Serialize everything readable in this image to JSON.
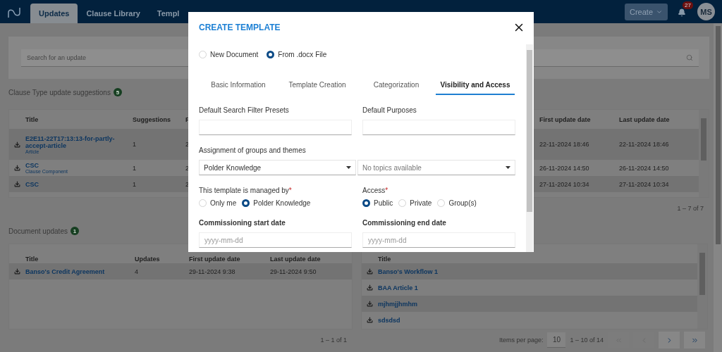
{
  "nav": {
    "tabs": [
      {
        "label": "Updates",
        "selected": true
      },
      {
        "label": "Clause Library",
        "selected": false
      },
      {
        "label": "Templ",
        "selected": false
      }
    ],
    "create": "Create",
    "notifications": "27",
    "avatar": "MS"
  },
  "search": {
    "placeholder": "Search for an update"
  },
  "clause_updates": {
    "title": "Clause Type update suggestions",
    "count": "5",
    "columns": [
      "Title",
      "Suggestions",
      "F",
      "First update date",
      "Last update date"
    ],
    "rows": [
      {
        "title": "E2E11-22T17:13:13-for-partly-accept-article",
        "type": "Article",
        "suggestions": "1",
        "column_3": "2",
        "first": "22-11-2024 18:46",
        "last": "22-11-2024 18:46"
      },
      {
        "title": "CSC",
        "type": "Clause Component",
        "suggestions": "1",
        "column_3": "2",
        "first": "26-11-2024 14:50",
        "last": "26-11-2024 14:50"
      },
      {
        "title": "CSC",
        "suggestions": "1",
        "column_3": "2",
        "first": "27-11-2024 10:34",
        "last": "27-11-2024 10:34"
      }
    ],
    "range": "1 – 7 of 7"
  },
  "document_updates": {
    "title": "Document updates",
    "count": "1",
    "columns": [
      "Title",
      "Updates",
      "First update date",
      "Last update date"
    ],
    "rows": [
      {
        "title": "Banso's Credit Agreement",
        "updates": "4",
        "first": "29-11-2024 9:38",
        "last": "29-11-2024 9:50"
      }
    ],
    "range": "1 – 1 of 1"
  },
  "workflow_updates": {
    "columns": [
      "Title"
    ],
    "rows": [
      {
        "title": "Banso's Workflow 1"
      },
      {
        "title": "BAA Article 1"
      },
      {
        "title": "mjhmjjhmhm"
      },
      {
        "title": "sdsdsd"
      }
    ],
    "items_per_page_label": "Items per page:",
    "items_per_page": "10",
    "range": "1 – 10 of 14",
    "pager": [
      {
        "kind": "first",
        "disabled": true
      },
      {
        "kind": "previous",
        "disabled": true
      },
      {
        "kind": "next",
        "disabled": false
      },
      {
        "kind": "last",
        "disabled": false
      }
    ]
  },
  "modal": {
    "title": "CREATE TEMPLATE",
    "source_options": [
      {
        "label": "New Document",
        "selected": false
      },
      {
        "label": "From .docx File",
        "selected": true
      }
    ],
    "tabs": [
      {
        "label": "Basic Information",
        "selected": false
      },
      {
        "label": "Template Creation",
        "selected": false
      },
      {
        "label": "Categorization",
        "selected": false
      },
      {
        "label": "Visibility and Access",
        "selected": true
      }
    ],
    "filters": [
      {
        "label": "Default Search Filter Presets"
      },
      {
        "label": "Default Purposes"
      }
    ],
    "assignment": {
      "label": "Assignment of groups and themes",
      "selects": [
        {
          "value": "Polder Knowledge"
        },
        {
          "placeholder": "No topics available"
        }
      ]
    },
    "radio_groups": [
      {
        "label": "This template is managed by",
        "required_mark": "*",
        "options": [
          {
            "label": "Only me",
            "selected": false
          },
          {
            "label": "Polder Knowledge",
            "selected": true
          }
        ]
      },
      {
        "label": "Access",
        "required_mark": "*",
        "options": [
          {
            "label": "Public",
            "selected": true
          },
          {
            "label": "Private",
            "selected": false
          },
          {
            "label": "Group(s)",
            "selected": false
          }
        ]
      }
    ],
    "dates": [
      {
        "label": "Commissioning start date",
        "placeholder": "yyyy-mm-dd"
      },
      {
        "label": "Commissioning end date",
        "placeholder": "yyyy-mm-dd"
      }
    ]
  }
}
